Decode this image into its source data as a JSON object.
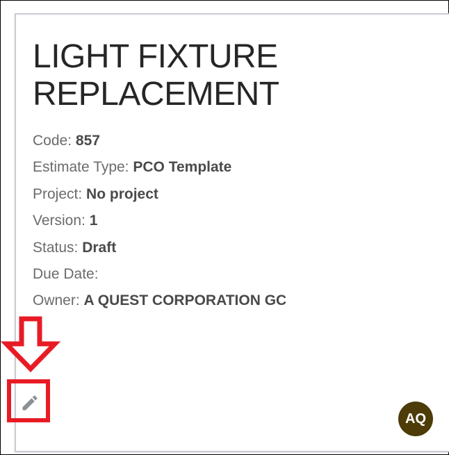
{
  "estimate": {
    "title_line1": "LIGHT FIXTURE",
    "title_line2": "REPLACEMENT",
    "fields": [
      {
        "label": "Code:",
        "value": "857"
      },
      {
        "label": "Estimate Type:",
        "value": "PCO Template"
      },
      {
        "label": "Project:",
        "value": "No project"
      },
      {
        "label": "Version:",
        "value": "1"
      },
      {
        "label": "Status:",
        "value": "Draft"
      },
      {
        "label": "Due Date:",
        "value": ""
      },
      {
        "label": "Owner:",
        "value": "A QUEST CORPORATION GC"
      }
    ]
  },
  "actions": {
    "edit_icon": "pencil-icon"
  },
  "owner_avatar": {
    "initials": "AQ",
    "color": "#4d3c08"
  },
  "annotation": {
    "color": "#e81b25",
    "arrow_icon": "down-arrow-icon"
  }
}
